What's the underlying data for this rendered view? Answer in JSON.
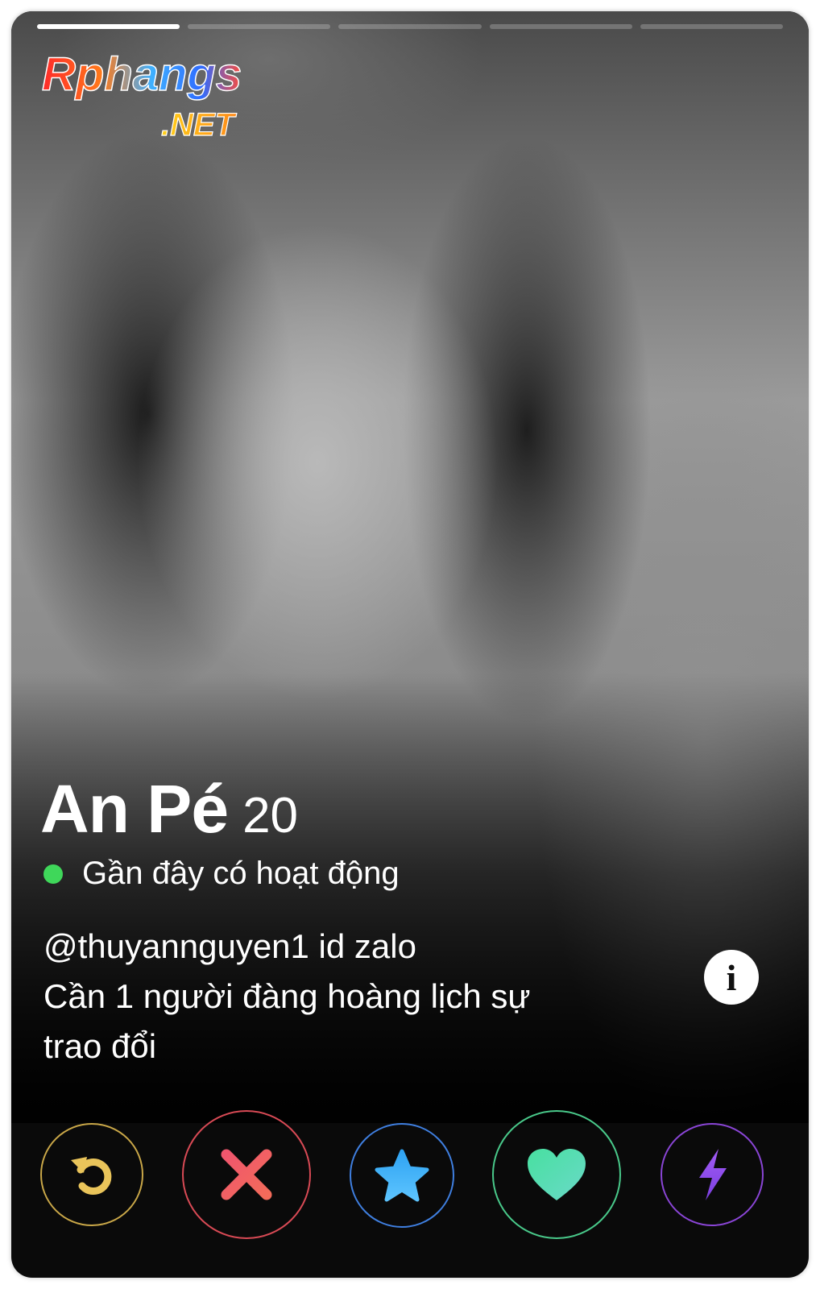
{
  "watermark": {
    "line1": "Rphangs",
    "line2": ".NET"
  },
  "progress": {
    "segments": 5,
    "active_index": 0
  },
  "profile": {
    "name": "An Pé",
    "age": "20",
    "status": "Gần đây có hoạt động",
    "bio": [
      "@thuyannguyen1  id zalo",
      "Cần 1 người đàng hoàng lịch sự",
      "trao đổi"
    ]
  },
  "info_button": {
    "icon": "info-icon",
    "glyph": "i"
  },
  "actions": [
    {
      "name": "rewind",
      "icon": "rewind-icon",
      "color": "#e9c45a"
    },
    {
      "name": "nope",
      "icon": "close-icon",
      "color": "#f0566d"
    },
    {
      "name": "super-like",
      "icon": "star-icon",
      "color": "#3aa7f0"
    },
    {
      "name": "like",
      "icon": "heart-icon",
      "color": "#4fe0a6"
    },
    {
      "name": "boost",
      "icon": "lightning-icon",
      "color": "#9b4df2"
    }
  ],
  "colors": {
    "online": "#3fd75a",
    "rewind_ring": "#c9a748",
    "nope_ring": "#d84a55",
    "superlike_ring": "#3f7fe0",
    "like_ring": "#49c98a",
    "boost_ring": "#8a45d6"
  }
}
